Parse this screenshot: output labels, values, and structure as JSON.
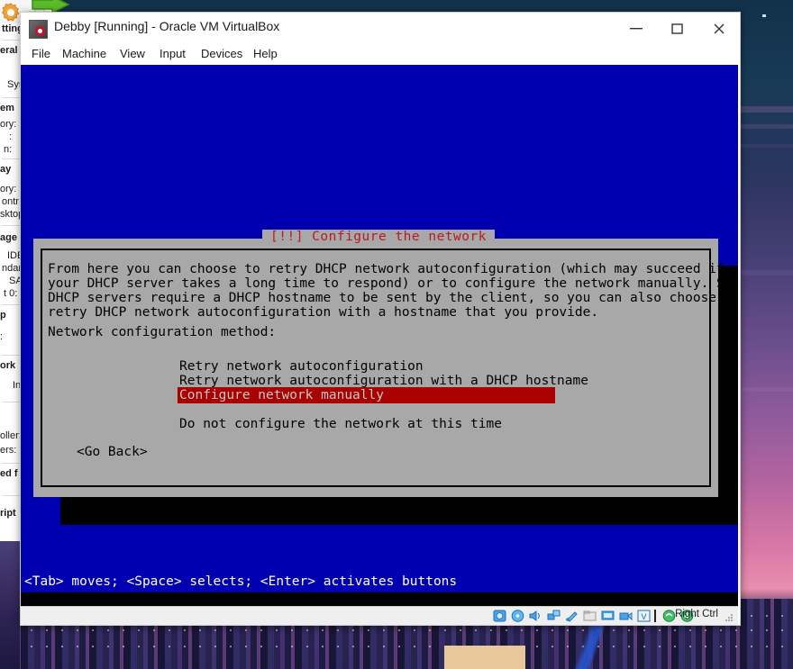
{
  "window": {
    "title": "Debby [Running] - Oracle VM VirtualBox",
    "icon_name": "virtualbox-vm-icon",
    "controls": {
      "minimize": "minimize",
      "maximize": "maximize",
      "close": "close"
    },
    "menu": [
      "File",
      "Machine",
      "View",
      "Input",
      "Devices",
      "Help"
    ]
  },
  "vm_screen": {
    "dialog": {
      "title": "[!!] Configure the network",
      "title_color": "#b81c1c",
      "body_text": "From here you can choose to retry DHCP network autoconfiguration (which may succeed if\nyour DHCP server takes a long time to respond) or to configure the network manually. Some\nDHCP servers require a DHCP hostname to be sent by the client, so you can also choose to\nretry DHCP network autoconfiguration with a hostname that you provide.",
      "prompt": "Network configuration method:",
      "options": [
        "Retry network autoconfiguration",
        "Retry network autoconfiguration with a DHCP hostname",
        "Configure network manually",
        "Do not configure the network at this time"
      ],
      "selected_index": 2,
      "selection_bg": "#a90000",
      "selection_fg": "#c8c8c8",
      "buttons": [
        "<Go Back>"
      ]
    },
    "help_bar": "<Tab> moves; <Space> selects; <Enter> activates buttons",
    "background_color": "#0000b0"
  },
  "status_bar": {
    "icons": [
      "hard-disk-icon",
      "optical-disk-icon",
      "audio-icon",
      "network-icon",
      "usb-icon",
      "shared-folders-icon",
      "display-icon",
      "recording-icon",
      "vm-features-icon",
      "mouse-integration-icon",
      "keyboard-icon"
    ],
    "host_key": "Right Ctrl"
  },
  "manager_window": {
    "toolbar_icons": [
      "settings-gear-icon",
      "discard-icon",
      "start-arrow-icon",
      "start-dropdown-icon"
    ],
    "visible_fragments": [
      "tting",
      "eral",
      "Syst",
      "em",
      "ory:",
      ":",
      "n:",
      "ay",
      "ory:",
      "ontr",
      "sktop",
      "age",
      "IDE",
      "ndar",
      "SAT",
      "t 0:",
      "p",
      ":",
      "ork",
      "In",
      "oller:",
      "ers:",
      "ed f",
      "ript"
    ]
  }
}
